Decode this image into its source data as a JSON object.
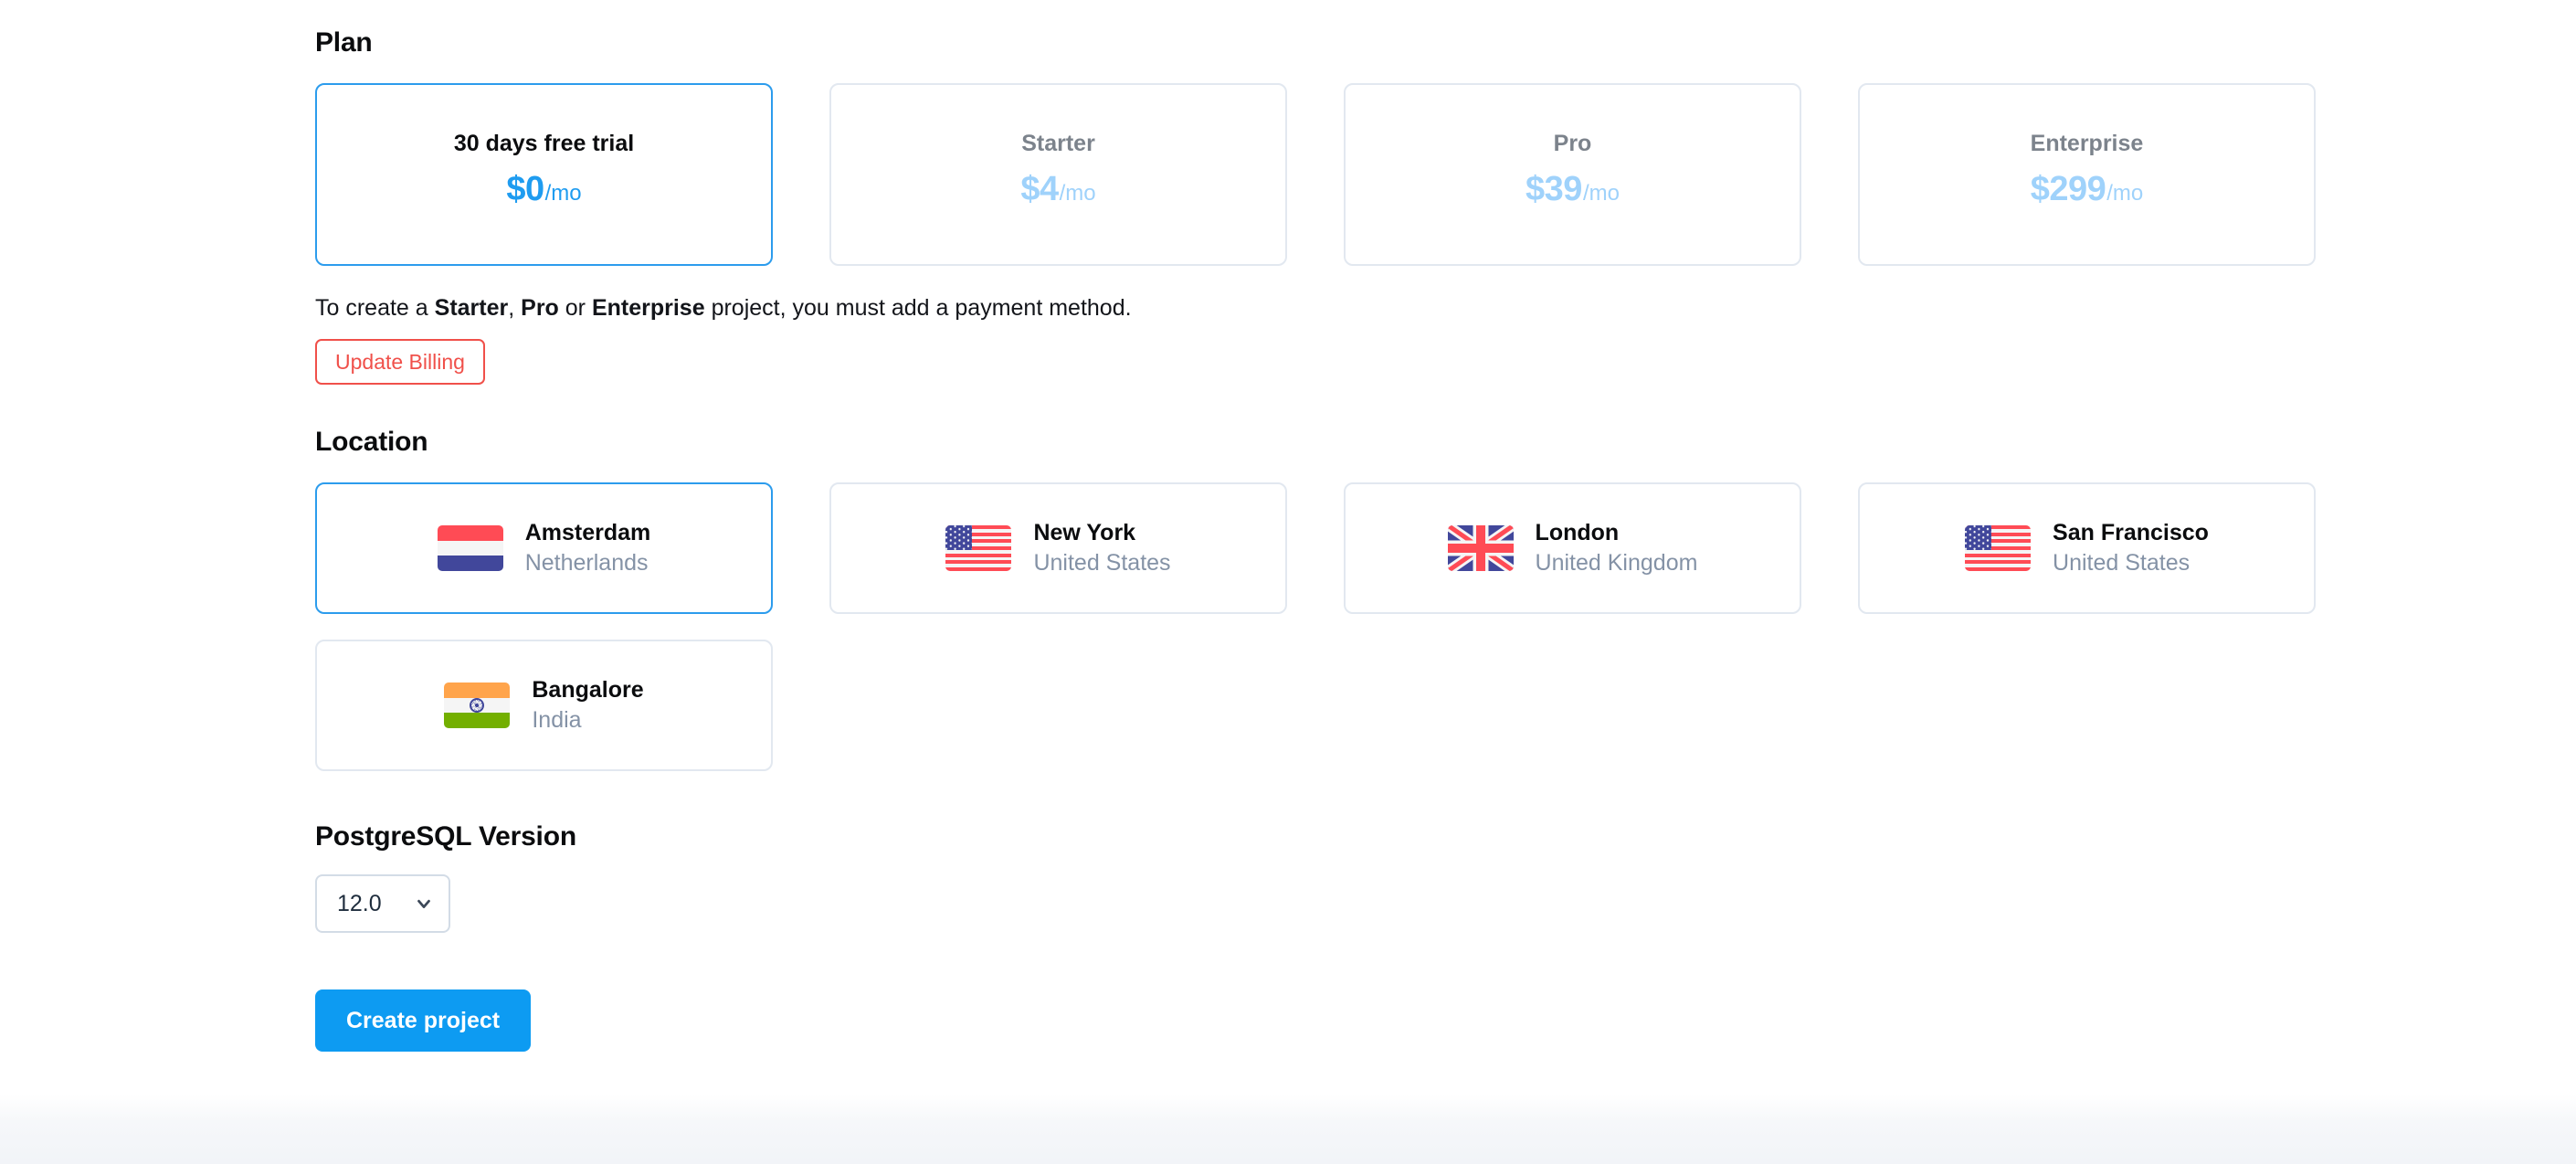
{
  "plan": {
    "section_label": "Plan",
    "cards": [
      {
        "name": "30 days free trial",
        "price": "$0",
        "period": "/mo",
        "selected": true
      },
      {
        "name": "Starter",
        "price": "$4",
        "period": "/mo",
        "selected": false
      },
      {
        "name": "Pro",
        "price": "$39",
        "period": "/mo",
        "selected": false
      },
      {
        "name": "Enterprise",
        "price": "$299",
        "period": "/mo",
        "selected": false
      }
    ],
    "notice": {
      "prefix": "To create a ",
      "plan_1": "Starter",
      "sep_1": ", ",
      "plan_2": "Pro",
      "sep_2": " or ",
      "plan_3": "Enterprise",
      "suffix": " project, you must add a payment method."
    },
    "update_billing_label": "Update Billing",
    "selected_border_color": "#2c9ced",
    "price_color_selected": "#1f9cf0",
    "price_color_muted": "#9fd2fb",
    "billing_button_color": "#f0504a"
  },
  "location": {
    "section_label": "Location",
    "cards": [
      {
        "city": "Amsterdam",
        "country": "Netherlands",
        "flag": "netherlands-flag-icon",
        "selected": true
      },
      {
        "city": "New York",
        "country": "United States",
        "flag": "united-states-flag-icon",
        "selected": false
      },
      {
        "city": "London",
        "country": "United Kingdom",
        "flag": "united-kingdom-flag-icon",
        "selected": false
      },
      {
        "city": "San Francisco",
        "country": "United States",
        "flag": "united-states-flag-icon",
        "selected": false
      },
      {
        "city": "Bangalore",
        "country": "India",
        "flag": "india-flag-icon",
        "selected": false
      }
    ]
  },
  "postgres": {
    "section_label": "PostgreSQL Version",
    "selected_version": "12.0",
    "options": [
      "12.0"
    ]
  },
  "footer": {
    "create_label": "Create project",
    "create_color": "#0d9bf2"
  }
}
